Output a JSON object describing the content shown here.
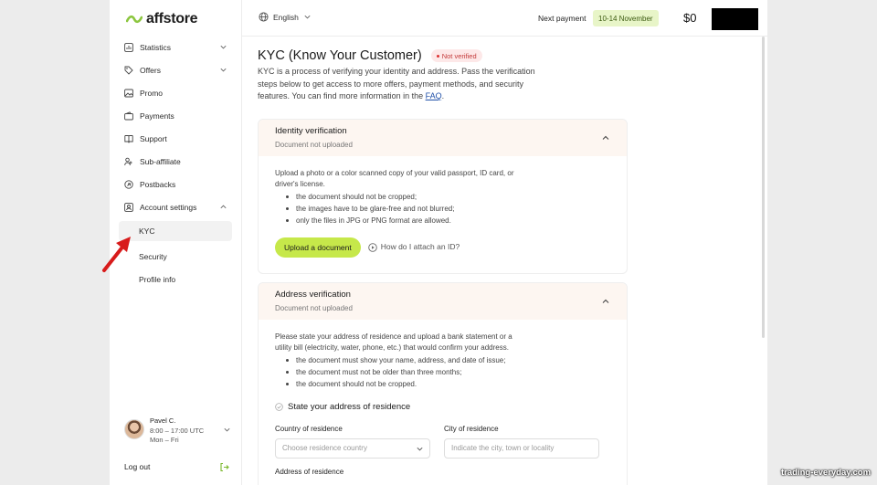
{
  "app": {
    "logo_text": "affstore",
    "brand_color": "#8cc63f"
  },
  "sidebar": {
    "items": [
      {
        "label": "Statistics",
        "icon": "chart-icon",
        "expandable": true
      },
      {
        "label": "Offers",
        "icon": "tag-icon",
        "expandable": true
      },
      {
        "label": "Promo",
        "icon": "image-icon",
        "expandable": false
      },
      {
        "label": "Payments",
        "icon": "wallet-icon",
        "expandable": false
      },
      {
        "label": "Support",
        "icon": "book-icon",
        "expandable": false
      },
      {
        "label": "Sub-affiliate",
        "icon": "users-icon",
        "expandable": false
      },
      {
        "label": "Postbacks",
        "icon": "link-icon",
        "expandable": false
      },
      {
        "label": "Account settings",
        "icon": "user-card-icon",
        "expandable": true,
        "expanded": true
      }
    ],
    "subitems": [
      {
        "label": "KYC",
        "active": true
      },
      {
        "label": "Security",
        "active": false
      },
      {
        "label": "Profile info",
        "active": false
      }
    ],
    "user": {
      "name": "Pavel C.",
      "hours": "8:00 – 17:00 UTC",
      "days": "Mon – Fri"
    },
    "logout_label": "Log out"
  },
  "topbar": {
    "language": "English",
    "next_payment_label": "Next payment",
    "next_payment_dates": "10-14 November",
    "balance": "$0"
  },
  "kyc": {
    "title": "KYC (Know Your Customer)",
    "status_badge": "Not verified",
    "intro": "KYC is a process of verifying your identity and address. Pass the verification steps below to get access to more offers, payment methods, and security features. You can find more information in the ",
    "faq_link": "FAQ",
    "intro_end": "."
  },
  "identity": {
    "title": "Identity verification",
    "status": "Document not uploaded",
    "description": "Upload a photo or a color scanned copy of your valid passport, ID card, or driver's license.",
    "rules": [
      "the document should not be cropped;",
      "the images have to be glare-free and not blurred;",
      "only the files in JPG or PNG format are allowed."
    ],
    "upload_button": "Upload a document",
    "help_link": "How do I attach an ID?"
  },
  "address": {
    "title": "Address verification",
    "status": "Document not uploaded",
    "description": "Please state your address of residence and upload a bank statement or a utility bill (electricity, water, phone, etc.) that would confirm your address.",
    "rules": [
      "the document must show your name, address, and date of issue;",
      "the document must not be older than three months;",
      "the document should not be cropped."
    ],
    "step_title": "State your address of residence",
    "country_label": "Country of residence",
    "country_placeholder": "Choose residence country",
    "city_label": "City of residence",
    "city_placeholder": "Indicate the city, town or locality",
    "address_label": "Address of residence"
  },
  "watermark": "trading-everyday.com"
}
